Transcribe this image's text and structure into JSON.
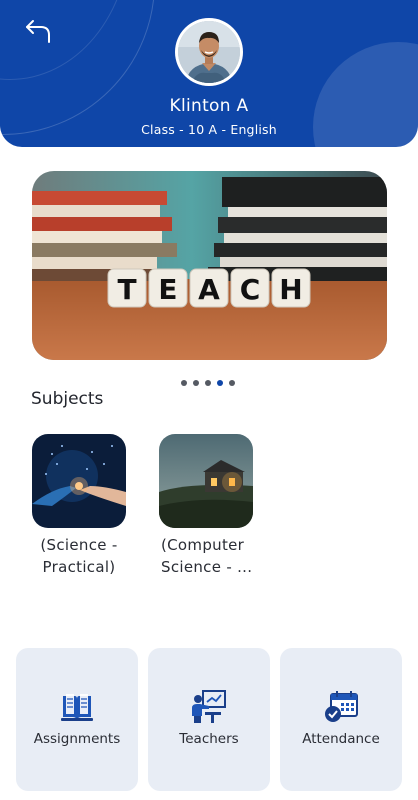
{
  "header": {
    "back_icon": "back-arrow-icon",
    "name": "Klinton A",
    "class_info": "Class - 10 A - English"
  },
  "banner": {
    "tiles": [
      "T",
      "E",
      "A",
      "C",
      "H"
    ],
    "slides_total": 5,
    "active_slide": 4
  },
  "subjects": {
    "title": "Subjects",
    "items": [
      {
        "label": "(Science - Practical)",
        "line1": "(Science -",
        "line2": "Practical)"
      },
      {
        "label": "(Computer Science - ...",
        "line1": "(Computer",
        "line2": "Science - ..."
      }
    ]
  },
  "actions": [
    {
      "label": "Assignments",
      "icon": "book-icon"
    },
    {
      "label": "Teachers",
      "icon": "teacher-board-icon"
    },
    {
      "label": "Attendance",
      "icon": "calendar-check-icon"
    }
  ],
  "colors": {
    "primary": "#0f46a8",
    "tile_bg": "#e8edf5"
  }
}
